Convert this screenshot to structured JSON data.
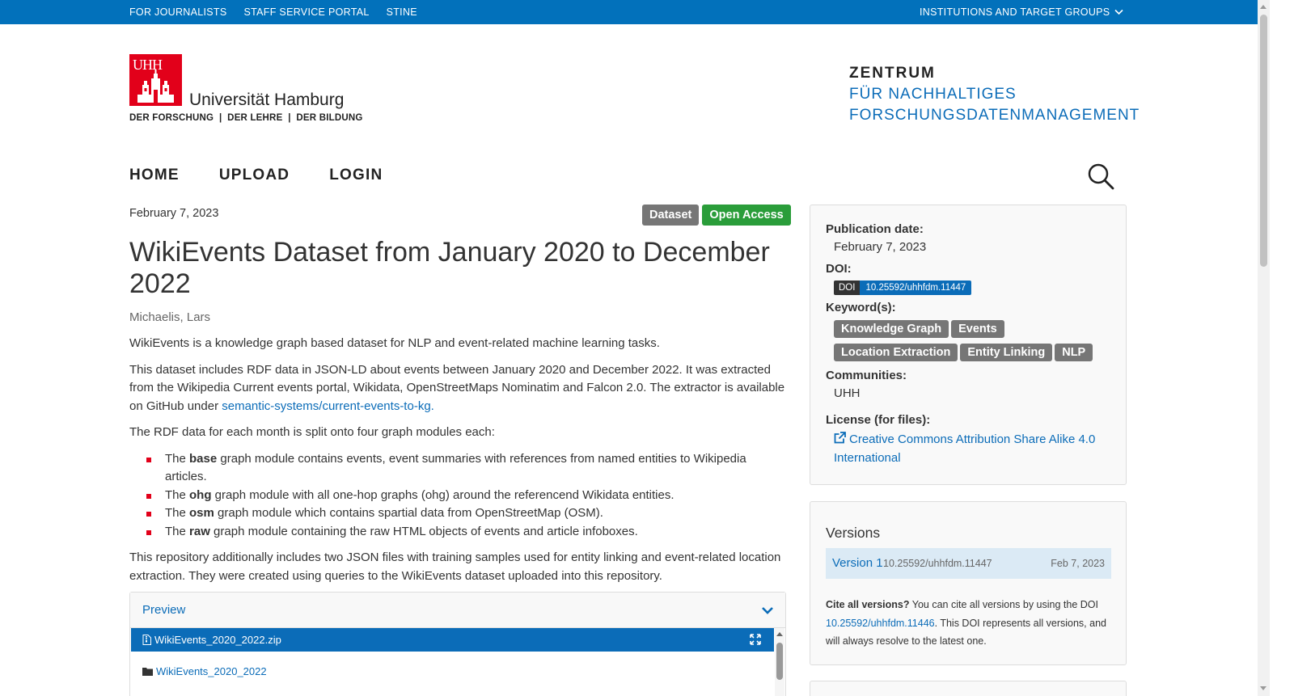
{
  "topbar": {
    "links": [
      "FOR JOURNALISTS",
      "STAFF SERVICE PORTAL",
      "STINE"
    ],
    "institutions": "INSTITUTIONS AND TARGET GROUPS"
  },
  "logo": {
    "mark_text": "UHH",
    "name": "Universität Hamburg",
    "tagline": "DER FORSCHUNG  |  DER LEHRE  |  DER BILDUNG"
  },
  "zentrum": {
    "line1": "ZENTRUM",
    "line2": "FÜR NACHHALTIGES",
    "line3": "FORSCHUNGSDATENMANAGEMENT"
  },
  "nav": {
    "home": "HOME",
    "upload": "UPLOAD",
    "login": "LOGIN"
  },
  "record": {
    "pub_date": "February 7, 2023",
    "badge_type": "Dataset",
    "badge_access": "Open Access",
    "title": "WikiEvents Dataset from January 2020 to December 2022",
    "creator": "Michaelis, Lars",
    "para1": "WikiEvents is a knowledge graph based dataset for NLP and event-related machine learning tasks.",
    "para2_a": "This dataset includes RDF data in JSON-LD about events between January 2020 and December 2022. It was extracted from the Wikipedia Current events portal, Wikidata, OpenStreetMaps Nominatim and Falcon 2.0. The extractor is available on GitHub under ",
    "para2_link": "semantic-systems/current-events-to-kg.",
    "para3": "The RDF data for each month is split onto four graph modules each:",
    "modules": [
      {
        "pre": "The ",
        "bold": "base",
        "post": " graph module contains events, event summaries with references from named entities to Wikipedia articles."
      },
      {
        "pre": "The ",
        "bold": "ohg",
        "post": " graph module with all one-hop graphs (ohg) around the referencend Wikidata entities."
      },
      {
        "pre": "The ",
        "bold": "osm",
        "post": " graph module which contains spartial data from OpenStreetMap (OSM)."
      },
      {
        "pre": "The ",
        "bold": "raw",
        "post": " graph module containing the raw HTML objects of events and article infoboxes."
      }
    ],
    "para4": "This repository additionally includes two JSON files with training samples used for entity linking and event-related location extraction. They were created using queries to the WikiEvents dataset uploaded into this repository."
  },
  "preview": {
    "header": "Preview",
    "file": "WikiEvents_2020_2022.zip",
    "folder": "WikiEvents_2020_2022"
  },
  "meta": {
    "pubdate_label": "Publication date:",
    "pubdate_value": "February 7, 2023",
    "doi_label": "DOI:",
    "doi_key": "DOI",
    "doi_value": "10.25592/uhhfdm.11447",
    "keywords_label": "Keyword(s):",
    "keywords": [
      "Knowledge Graph",
      "Events",
      "Location Extraction",
      "Entity Linking",
      "NLP"
    ],
    "communities_label": "Communities:",
    "community": "UHH",
    "license_label": "License (for files):",
    "license": "Creative Commons Attribution Share Alike 4.0 International"
  },
  "versions": {
    "heading": "Versions",
    "version_name": "Version 1",
    "version_doi": "10.25592/uhhfdm.11447",
    "version_date": "Feb 7, 2023",
    "cite_bold": "Cite all versions?",
    "cite_text1": " You can cite all versions by using the DOI ",
    "cite_doi": "10.25592/uhhfdm.11446",
    "cite_text2": ". This DOI represents all versions, and will always resolve to the latest one."
  },
  "colors": {
    "brand_blue": "#0271bb",
    "link_blue": "#0b6cb8",
    "uhh_red": "#e2001a",
    "open_access_green": "#2a9d3a"
  }
}
